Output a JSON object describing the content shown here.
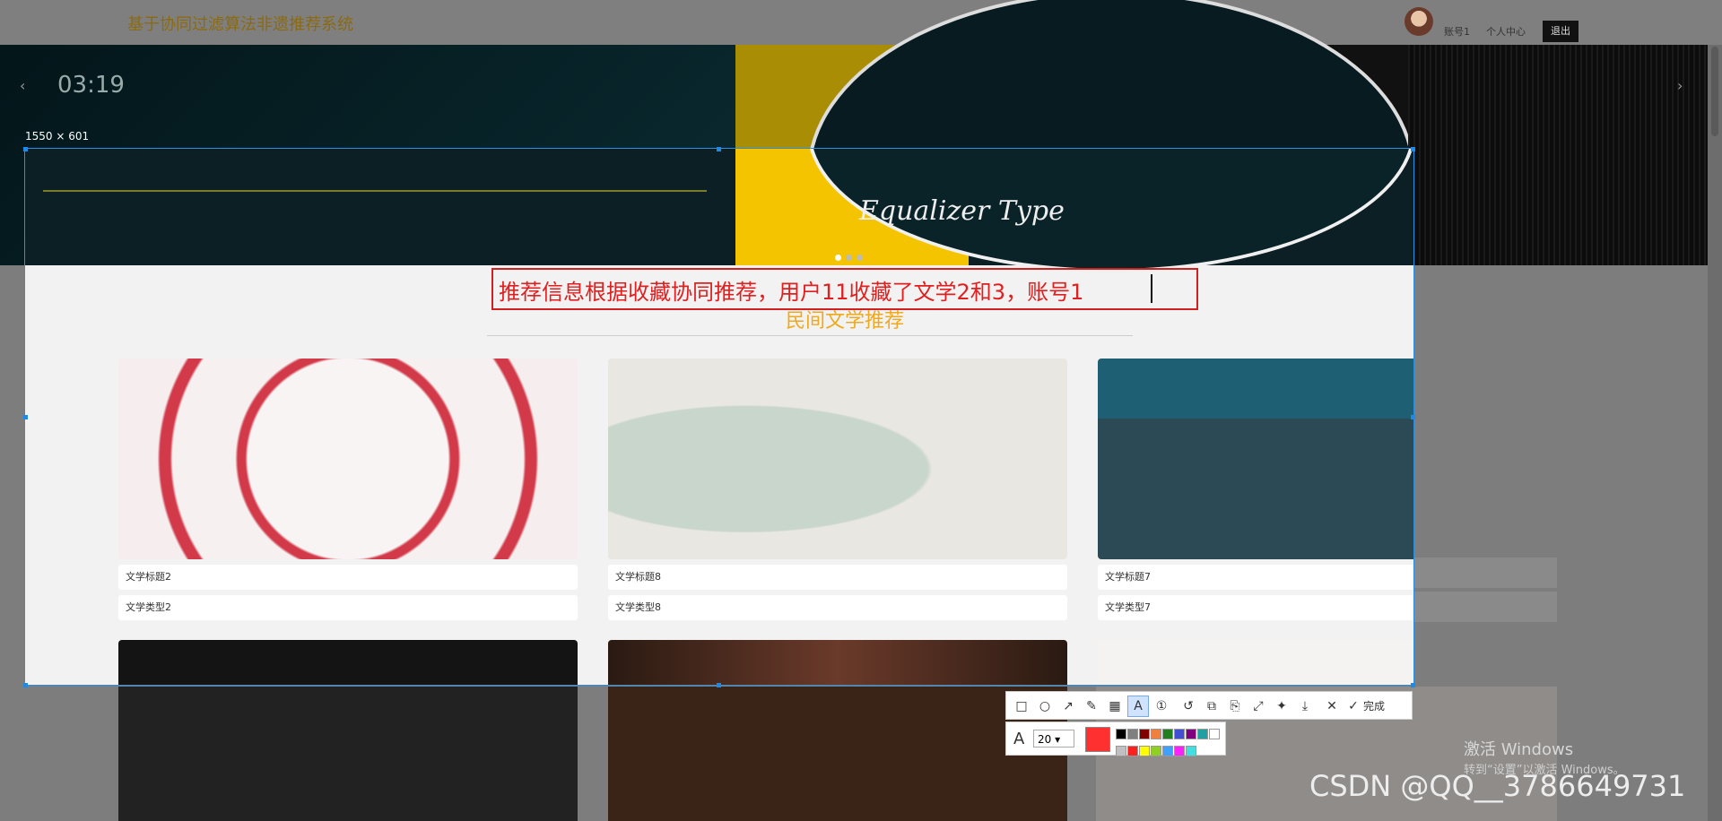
{
  "site": {
    "title": "基于协同过滤算法非遗推荐系统"
  },
  "nav": {
    "account": "账号1",
    "center": "个人中心",
    "logout": "退出"
  },
  "banner": {
    "time": "03:19",
    "prev": "‹",
    "next": "›",
    "caption": "Equalizer Type"
  },
  "screenshot_tool": {
    "size_label": "1550 × 601",
    "annotation_text": "推荐信息根据收藏协同推荐，用户11收藏了文学2和3，账号1",
    "font_size": "20",
    "done_label": "完成",
    "current_color": "#ff3030",
    "palette": [
      "#000000",
      "#808080",
      "#800000",
      "#f08040",
      "#208020",
      "#4050d0",
      "#800080",
      "#20a0a0",
      "#ffffff",
      "#c0c0c0",
      "#ff2020",
      "#ffff00",
      "#90d020",
      "#40a0ff",
      "#ff20ff",
      "#40e0e0"
    ],
    "tools": [
      "rect-tool",
      "ellipse-tool",
      "arrow-tool",
      "pencil-tool",
      "mosaic-tool",
      "text-tool",
      "number-tool",
      "undo-tool",
      "ocr-tool",
      "translate-tool",
      "scroll-capture-tool",
      "pin-tool",
      "download-tool",
      "cancel-tool"
    ]
  },
  "section": {
    "title": "民间文学推荐"
  },
  "cards": [
    {
      "title": "文学标题2",
      "type": "文学类型2",
      "color": "#f4eeee"
    },
    {
      "title": "文学标题8",
      "type": "文学类型8",
      "color": "#e9e7e2"
    },
    {
      "title": "文学标题7",
      "type": "文学类型7",
      "color": "#1f5f73"
    },
    {
      "title": "",
      "type": "",
      "color": "#141414"
    },
    {
      "title": "",
      "type": "",
      "color": "#3a2418"
    },
    {
      "title": "",
      "type": "",
      "color": "#f5f3f1"
    }
  ],
  "overlay": {
    "windows_activate": "激活 Windows",
    "windows_hint": "转到“设置”以激活 Windows。",
    "csdn_watermark": "CSDN @QQ__3786649731"
  }
}
